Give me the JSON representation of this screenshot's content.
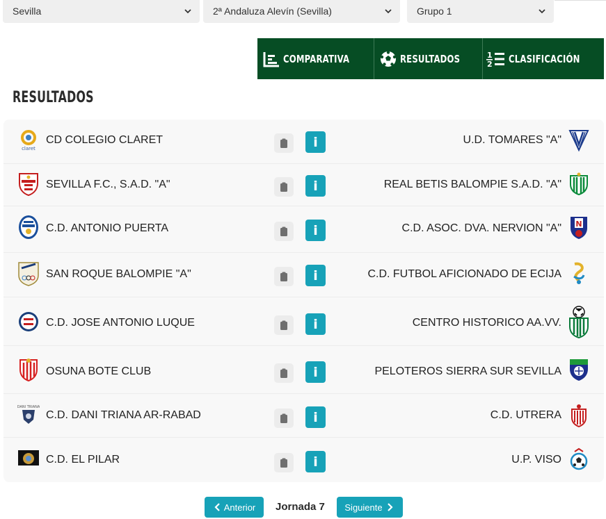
{
  "filters": {
    "region": "Sevilla",
    "competition": "2ª Andaluza Alevín (Sevilla)",
    "group": "Grupo 1"
  },
  "tabs": [
    {
      "label": "COMPARATIVA",
      "icon": "bar-chart-icon"
    },
    {
      "label": "RESULTADOS",
      "icon": "soccer-ball-icon"
    },
    {
      "label": "CLASIFICACIÓN",
      "icon": "ranking-list-icon"
    }
  ],
  "section_title": "RESULTADOS",
  "matches": [
    {
      "home": "CD COLEGIO CLARET",
      "away": "U.D. TOMARES \"A\""
    },
    {
      "home": "SEVILLA F.C., S.A.D. \"A\"",
      "away": "REAL BETIS BALOMPIE S.A.D. \"A\""
    },
    {
      "home": "C.D. ANTONIO PUERTA",
      "away": "C.D. ASOC. DVA. NERVION \"A\""
    },
    {
      "home": "SAN ROQUE BALOMPIE \"A\"",
      "away": "C.D. FUTBOL AFICIONADO DE ECIJA"
    },
    {
      "home": "C.D. JOSE ANTONIO LUQUE",
      "away": "CENTRO HISTORICO AA.VV."
    },
    {
      "home": "OSUNA BOTE CLUB",
      "away": "PELOTEROS SIERRA SUR SEVILLA"
    },
    {
      "home": "C.D. DANI TRIANA AR-RABAD",
      "away": "C.D. UTRERA"
    },
    {
      "home": "C.D. EL PILAR",
      "away": "U.P. VISO"
    }
  ],
  "info_label": "i",
  "pagination": {
    "prev": "Anterior",
    "current": "Jornada 7",
    "next": "Siguiente"
  },
  "colors": {
    "tabbar": "#064d24",
    "accent": "#17a2b8"
  }
}
